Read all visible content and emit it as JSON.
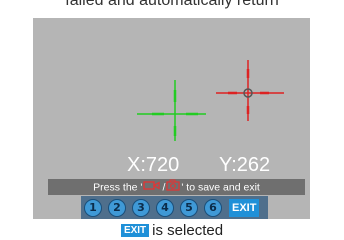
{
  "captions": {
    "top": "failed and automatically return",
    "bottom_chip": "EXIT",
    "bottom_text": "is selected"
  },
  "screen": {
    "coord_x": "X:720",
    "coord_y": "Y:262",
    "instruction_before": "Press the '",
    "instruction_sep": "/",
    "instruction_after": "' to save and exit",
    "buttons": [
      "1",
      "2",
      "3",
      "4",
      "5",
      "6"
    ],
    "exit_label": "EXIT",
    "icons": [
      "video-record-icon",
      "camera-icon"
    ],
    "colors": {
      "green_crosshair": "#22cc22",
      "red_crosshair": "#dd2222",
      "button_blue": "#3f99d6",
      "exit_blue": "#1f90d8"
    }
  }
}
